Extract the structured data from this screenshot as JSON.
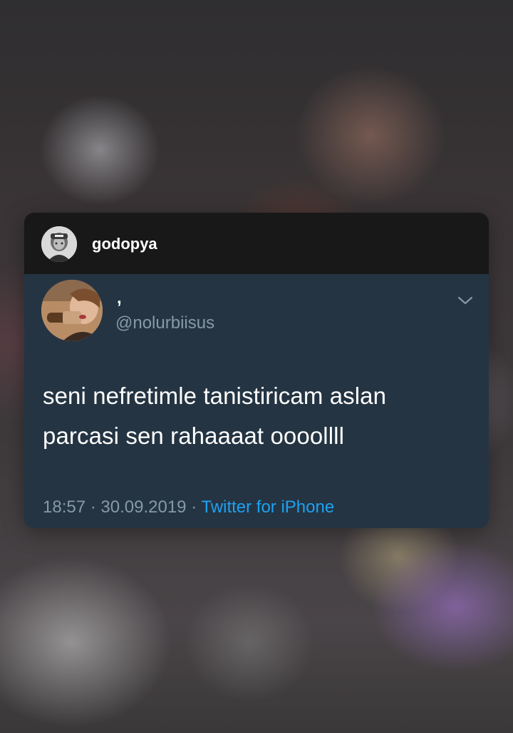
{
  "post": {
    "username": "godopya"
  },
  "tweet": {
    "display_name": ",",
    "handle": "@nolurbiisus",
    "text_lines": [
      "seni nefretimle tanistiricam aslan",
      "parcasi sen rahaaaat oooollll"
    ],
    "time": "18:57",
    "separator": "·",
    "date": "30.09.2019",
    "source": "Twitter for iPhone"
  },
  "colors": {
    "header_bg": "#181818",
    "tweet_bg": "#243442",
    "muted_text": "#8899a6",
    "link": "#1da1f2"
  },
  "icons": {
    "menu": "chevron-down-icon"
  }
}
